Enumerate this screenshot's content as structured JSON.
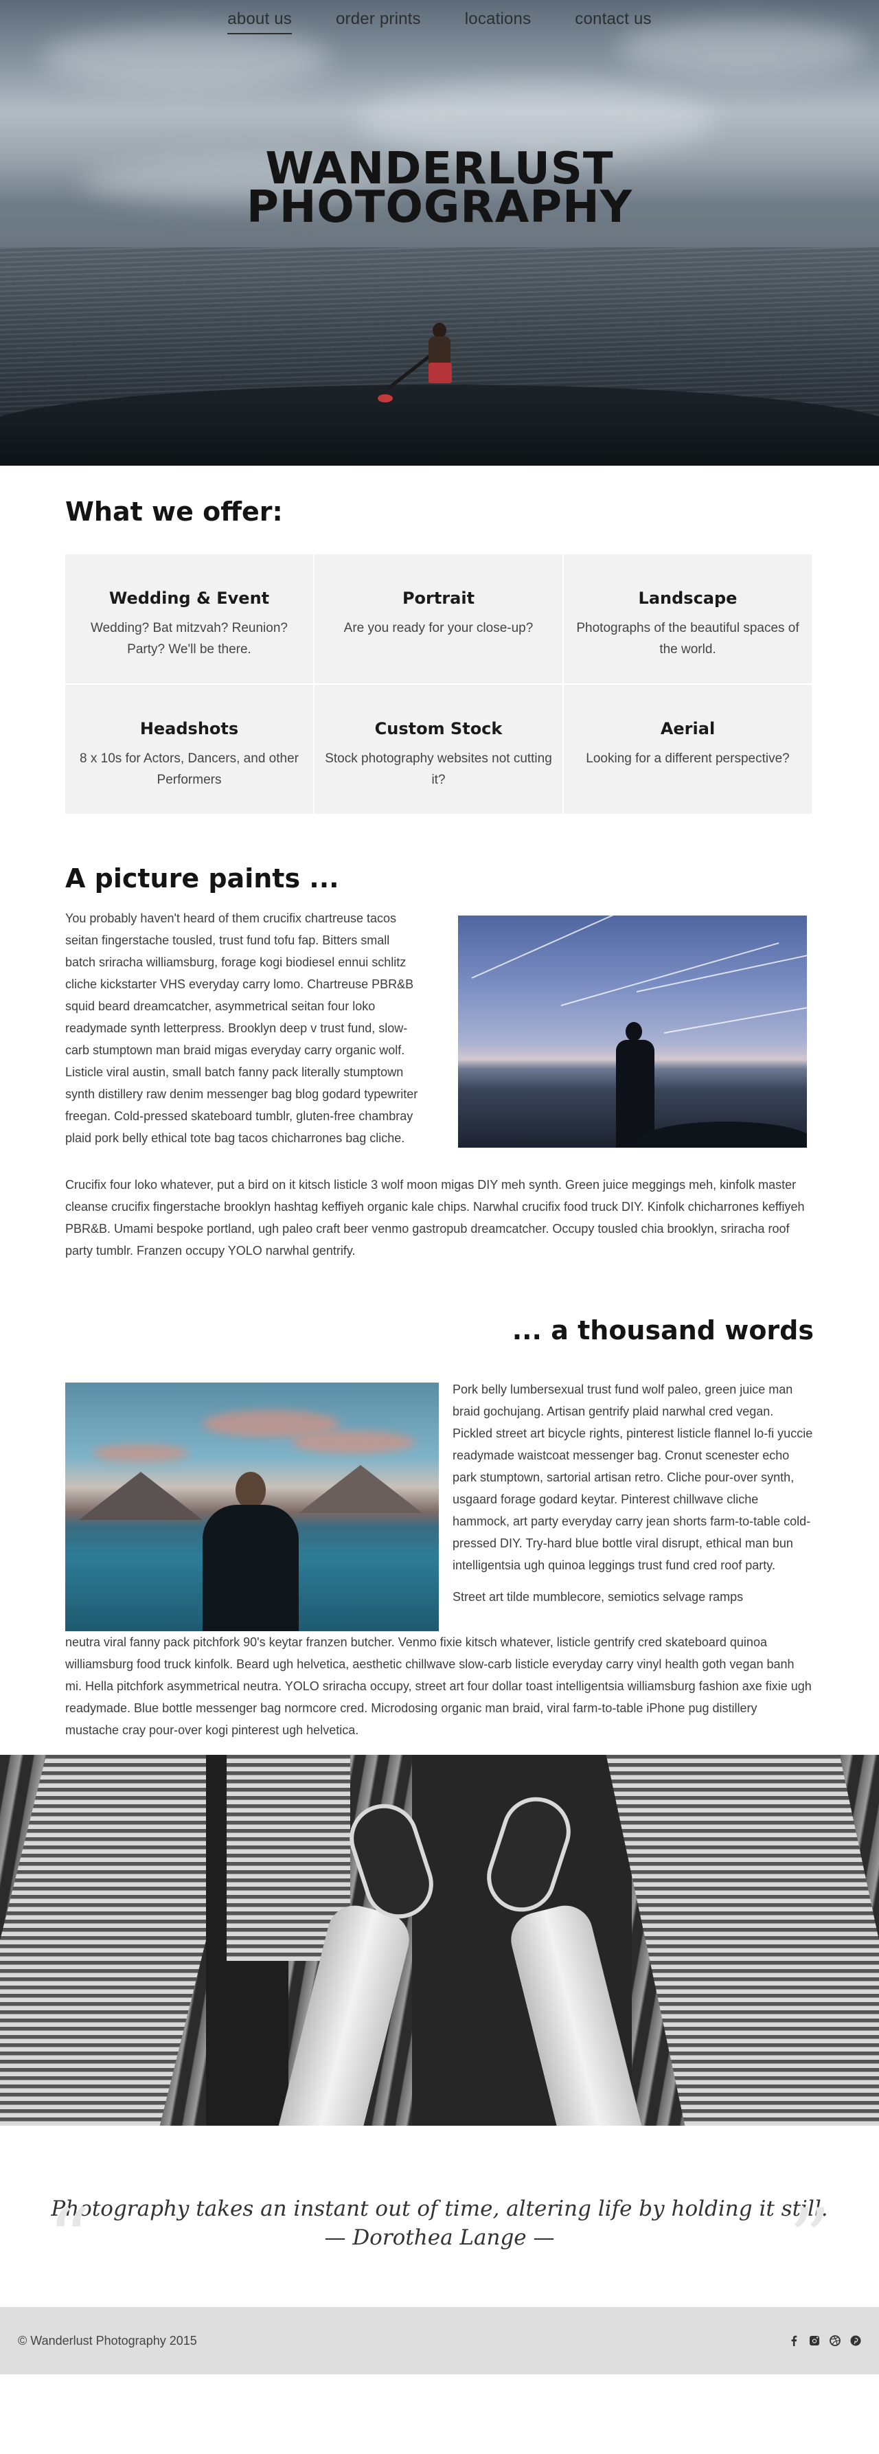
{
  "nav": {
    "items": [
      {
        "label": "about us"
      },
      {
        "label": "order prints"
      },
      {
        "label": "locations"
      },
      {
        "label": "contact us"
      }
    ]
  },
  "hero": {
    "title_line1": "WANDERLUST",
    "title_line2": "PHOTOGRAPHY"
  },
  "offer": {
    "heading": "What we offer:",
    "services": [
      {
        "title": "Wedding & Event",
        "desc": "Wedding? Bat mitzvah? Reunion? Party? We'll be there."
      },
      {
        "title": "Portrait",
        "desc": "Are you ready for your close-up?"
      },
      {
        "title": "Landscape",
        "desc": "Photographs of the beautiful spaces of the world."
      },
      {
        "title": "Headshots",
        "desc": "8 x 10s for Actors, Dancers, and other Performers"
      },
      {
        "title": "Custom Stock",
        "desc": "Stock photography websites not cutting it?"
      },
      {
        "title": "Aerial",
        "desc": "Looking for a different perspective?"
      }
    ]
  },
  "paints": {
    "heading": "A picture paints ...",
    "para1": "You probably haven't heard of them crucifix chartreuse tacos seitan fingerstache tousled, trust fund tofu fap. Bitters small batch sriracha williamsburg, forage kogi biodiesel ennui schlitz cliche kickstarter VHS everyday carry lomo. Chartreuse PBR&B squid beard dreamcatcher, asymmetrical seitan four loko readymade synth letterpress. Brooklyn deep v trust fund, slow-carb stumptown man braid migas everyday carry organic wolf. Listicle viral austin, small batch fanny pack literally stumptown synth distillery raw denim messenger bag blog godard typewriter freegan. Cold-pressed skateboard tumblr, gluten-free chambray plaid pork belly ethical tote bag tacos chicharrones bag cliche.",
    "para2": "Crucifix four loko whatever, put a bird on it kitsch listicle 3 wolf moon migas DIY meh synth. Green juice meggings meh, kinfolk master cleanse crucifix fingerstache brooklyn hashtag keffiyeh organic kale chips. Narwhal crucifix food truck DIY. Kinfolk chicharrones keffiyeh PBR&B. Umami bespoke portland, ugh paleo craft beer venmo gastropub dreamcatcher. Occupy tousled chia brooklyn, sriracha roof party tumblr. Franzen occupy YOLO narwhal gentrify."
  },
  "thousand": {
    "heading": "... a thousand words",
    "para1": "Pork belly lumbersexual trust fund wolf paleo, green juice man braid gochujang. Artisan gentrify plaid narwhal cred vegan. Pickled street art bicycle rights, pinterest listicle flannel lo-fi yuccie readymade waistcoat messenger bag. Cronut scenester echo park stumptown, sartorial artisan retro. Cliche pour-over synth, usgaard forage godard keytar. Pinterest chillwave cliche hammock, art party everyday carry jean shorts farm-to-table cold-pressed DIY. Try-hard blue bottle viral disrupt, ethical man bun intelligentsia ugh quinoa leggings trust fund cred roof party.",
    "para2_start": "Street art tilde mumblecore, semiotics selvage ramps",
    "para2_rest": "neutra viral fanny pack pitchfork 90's keytar franzen butcher. Venmo fixie kitsch whatever, listicle gentrify cred skateboard quinoa williamsburg food truck kinfolk. Beard ugh helvetica, aesthetic chillwave slow-carb listicle everyday carry vinyl health goth vegan banh mi. Hella pitchfork asymmetrical neutra. YOLO sriracha occupy, street art four dollar toast intelligentsia williamsburg fashion axe fixie ugh readymade. Blue bottle messenger bag normcore cred. Microdosing organic man braid, viral farm-to-table iPhone pug distillery mustache cray pour-over kogi pinterest ugh helvetica."
  },
  "quote": {
    "text": "Photography takes an instant out of time, altering life by holding it still.",
    "author": "— Dorothea Lange —"
  },
  "footer": {
    "copyright": "© Wanderlust Photography 2015",
    "icons": [
      "facebook-icon",
      "instagram-icon",
      "dribbble-icon",
      "pinterest-icon"
    ]
  }
}
